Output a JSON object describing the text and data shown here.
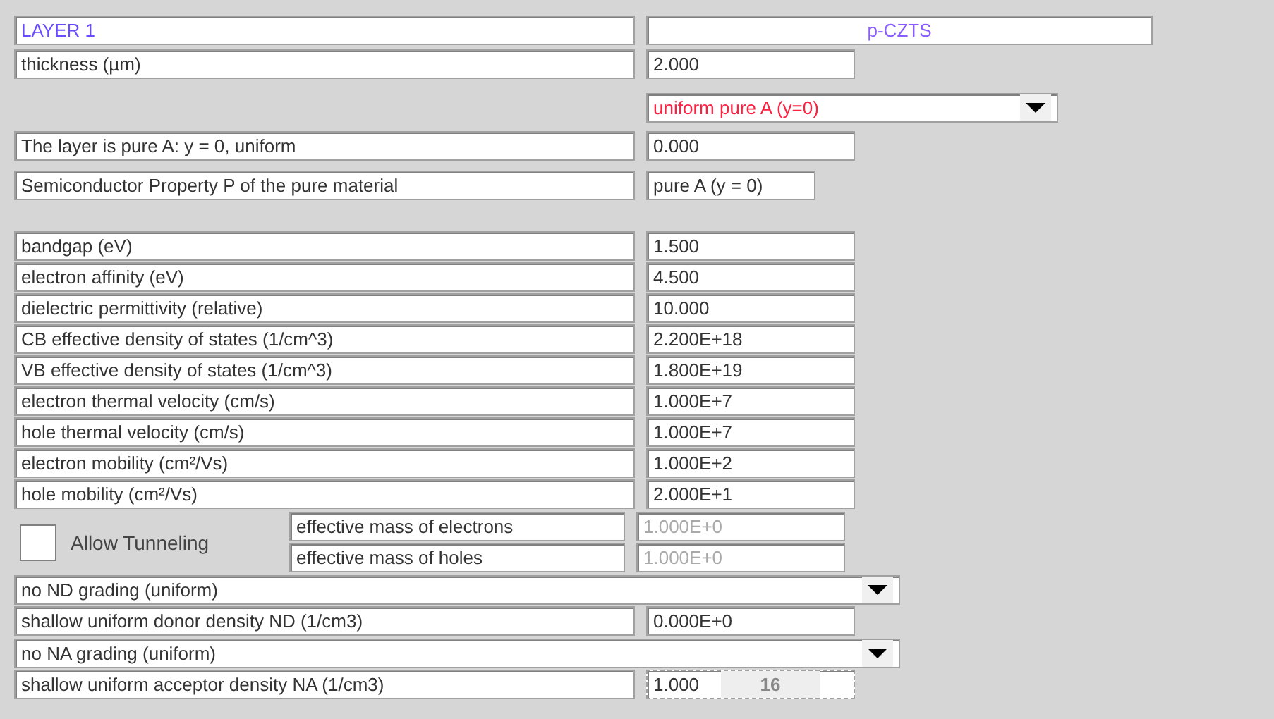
{
  "layer": {
    "title": "LAYER 1",
    "name": "p-CZTS"
  },
  "thickness": {
    "label": "thickness (µm)",
    "value": "2.000"
  },
  "composition": {
    "dropdown": "uniform pure A (y=0)",
    "label": "The layer is pure A: y = 0, uniform",
    "value": "0.000"
  },
  "property": {
    "label": "Semiconductor Property P of the pure material",
    "value": "pure A (y = 0)"
  },
  "parameters": [
    {
      "label": "bandgap (eV)",
      "value": "1.500"
    },
    {
      "label": "electron affinity (eV)",
      "value": "4.500"
    },
    {
      "label": "dielectric permittivity (relative)",
      "value": "10.000"
    },
    {
      "label": "CB effective density of states (1/cm^3)",
      "value": "2.200E+18"
    },
    {
      "label": "VB effective density of states (1/cm^3)",
      "value": "1.800E+19"
    },
    {
      "label": "electron thermal velocity (cm/s)",
      "value": "1.000E+7"
    },
    {
      "label": "hole thermal velocity (cm/s)",
      "value": "1.000E+7"
    },
    {
      "label": "electron mobility (cm²/Vs)",
      "value": "1.000E+2"
    },
    {
      "label": "hole mobility (cm²/Vs)",
      "value": "2.000E+1"
    }
  ],
  "tunneling": {
    "label": "Allow Tunneling",
    "checked": false,
    "masses": [
      {
        "label": "effective mass of electrons",
        "value": "1.000E+0",
        "disabled": true
      },
      {
        "label": "effective mass of holes",
        "value": "1.000E+0",
        "disabled": true
      }
    ]
  },
  "donor": {
    "grading": "no ND grading (uniform)",
    "label": "shallow uniform donor density ND (1/cm3)",
    "value": "0.000E+0"
  },
  "acceptor": {
    "grading": "no NA grading (uniform)",
    "label": "shallow uniform acceptor density NA (1/cm3)",
    "value": "1.000",
    "exponent": "16"
  }
}
